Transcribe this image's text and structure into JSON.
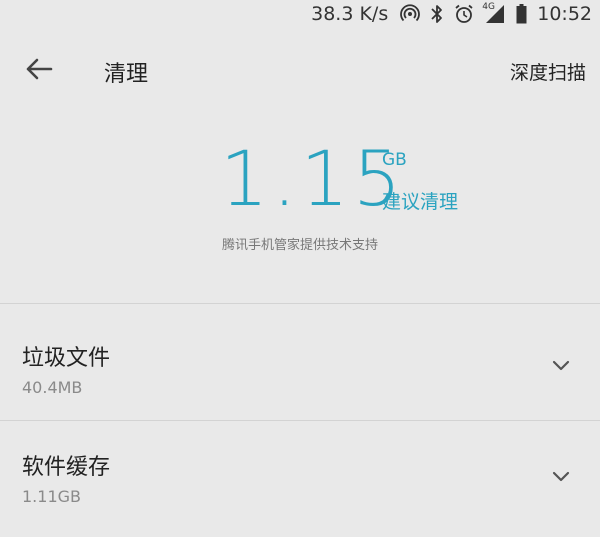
{
  "status_bar": {
    "speed": "38.3 K/s",
    "network_tag": "4G",
    "time": "10:52",
    "icons": [
      "hotspot-icon",
      "bluetooth-icon",
      "alarm-icon",
      "signal-icon",
      "battery-icon"
    ]
  },
  "toolbar": {
    "title": "清理",
    "action_label": "深度扫描"
  },
  "summary": {
    "value": "1.15",
    "unit": "GB",
    "suggestion": "建议清理",
    "powered_by": "腾讯手机管家提供技术支持"
  },
  "items": [
    {
      "title": "垃圾文件",
      "size": "40.4MB"
    },
    {
      "title": "软件缓存",
      "size": "1.11GB"
    }
  ],
  "colors": {
    "accent": "#2ba3c0",
    "background": "#e9e9e9",
    "text": "#222222",
    "secondary_text": "#8a8a8a"
  }
}
